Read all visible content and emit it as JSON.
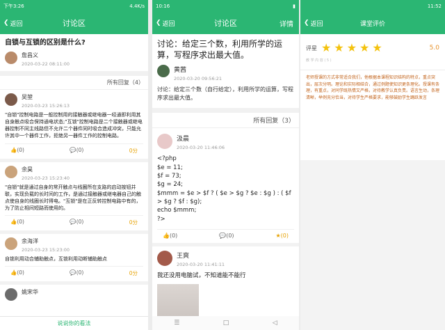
{
  "panel1": {
    "status": {
      "time": "下午3:26",
      "right": "4.4K/s"
    },
    "back_label": "返回",
    "title": "讨论区",
    "question": "自锁与互锁的区别是什么?",
    "author": "詹昌义",
    "date": "2020-03-22 08:11:00",
    "all_replies": "所有回复（4）",
    "replies": [
      {
        "name": "吴堃",
        "time": "2020-03-23 15:26:13",
        "body": "\"自锁\"控制电路是一般控制用的接触器或继电器一经通即利用其自身触点吸合保持通电状态;\"互锁\"控制电路是二个接触器或继电器控制不同主线路但不允许二个器件同时吸合造成冲突，只能允许其中一个器件工作，拒绝另一器件工作的控制电路。",
        "likes": "(0)",
        "comments": "(0)",
        "score": "0分"
      },
      {
        "name": "余昊",
        "time": "2020-03-23 15:23:40",
        "body": "\"自锁\"就是通过自身的常开触点与线圈所在支路的启动按钮并联，实现负载的长时间的工作，是通过接触器或继电器自己的触点使自身的线圈长时得电。\"互锁\"是在正反转控制电路中有的，为了防止相间短路而使用的。",
        "likes": "(0)",
        "comments": "(0)",
        "score": "0分"
      },
      {
        "name": "余海洋",
        "time": "2020-03-23 15:23:00",
        "body": "自锁利用动合辅助触点，互锁利用动断辅助触点",
        "likes": "(0)",
        "comments": "(0)",
        "score": "0分"
      },
      {
        "name": "姚宋华",
        "time": "",
        "body": "",
        "likes": "",
        "comments": "",
        "score": ""
      }
    ],
    "bottom_btn": "说说你的看法"
  },
  "panel2": {
    "status": {
      "time": "10:16"
    },
    "back_label": "返回",
    "title": "讨论区",
    "right": "详情",
    "question": "讨论：给定三个数，利用所学的运算，写程序求出最大值。",
    "author": "黄茜",
    "date": "2020-03-20 09:56:21",
    "content": "讨论：给定三个数（自行给定），利用所学的运算，写程序求出最大值。",
    "all_replies": "所有回复（3）",
    "reply1": {
      "name": "汲晨",
      "time": "2020-03-20 11:46:06",
      "body": "<?php\n$e = 11;\n$f = 73;\n$g = 24;\n$mmm = $e > $f ? ( $e > $g ? $e : $g ) : ( $f > $g ? $f : $g);\necho $mmm;\n?>",
      "likes": "(0)",
      "comments": "(0)",
      "score": "(0)"
    },
    "reply2": {
      "name": "王爽",
      "time": "2020-03-20 11:41:11",
      "body": "我还没用电脑试，不知道能不能行"
    }
  },
  "panel3": {
    "status": {
      "time": "11:52"
    },
    "back_label": "返回",
    "title": "课堂评价",
    "rating_label": "评星",
    "rating_value": "5.0",
    "stars": 5,
    "sub_note": "教 学 内 容 ( 5 )",
    "comment": "老师授课的方式非常适合我们，他根据本课程知识结构的特点，重点突出，层次分明。理论和实际相结合，通过例题使知识更条理化。授课有条理，有重点，对同学既热情又严格，对待教学认真负责。语言生动，条理清晰，举例充分恰当，对待学生严格要求，能够鼓励学生踊跃发言"
  }
}
